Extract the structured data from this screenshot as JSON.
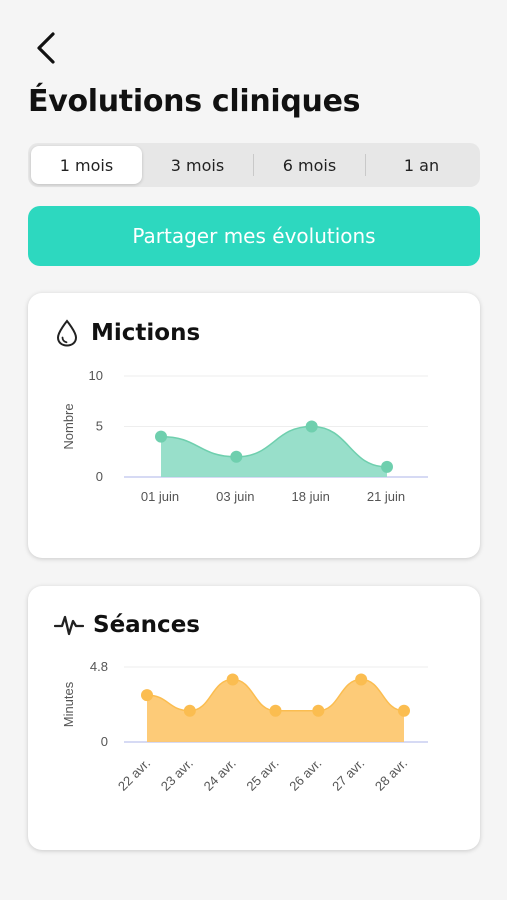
{
  "header": {
    "title": "Évolutions cliniques",
    "back_icon": "chevron-left-icon"
  },
  "period_tabs": [
    {
      "label": "1 mois",
      "active": true
    },
    {
      "label": "3 mois",
      "active": false
    },
    {
      "label": "6 mois",
      "active": false
    },
    {
      "label": "1 an",
      "active": false
    }
  ],
  "share_button": {
    "label": "Partager mes évolutions",
    "color": "#2dd8bf"
  },
  "mictions_card": {
    "title": "Mictions",
    "icon": "water-drop-icon"
  },
  "seances_card": {
    "title": "Séances",
    "icon": "heartbeat-icon"
  },
  "chart_data": [
    {
      "type": "area",
      "title": "Mictions",
      "xlabel": "",
      "ylabel": "Nombre",
      "categories": [
        "01 juin",
        "03 juin",
        "18 juin",
        "21 juin"
      ],
      "values": [
        4,
        2,
        5,
        1
      ],
      "ylim": [
        0,
        10
      ],
      "yticks": [
        "0",
        "5",
        "10"
      ],
      "color": "#8fdcc5",
      "point_color": "#6fcfae",
      "grid": true
    },
    {
      "type": "area",
      "title": "Séances",
      "xlabel": "",
      "ylabel": "Minutes",
      "categories": [
        "22 avr.",
        "23 avr.",
        "24 avr.",
        "25 avr.",
        "26 avr.",
        "27 avr.",
        "28 avr."
      ],
      "values": [
        3,
        2,
        4,
        2,
        2,
        4,
        2
      ],
      "ylim": [
        0,
        4.8
      ],
      "yticks": [
        "0",
        "4.8"
      ],
      "color": "#fdc76c",
      "point_color": "#fbbd50",
      "grid": true
    }
  ]
}
